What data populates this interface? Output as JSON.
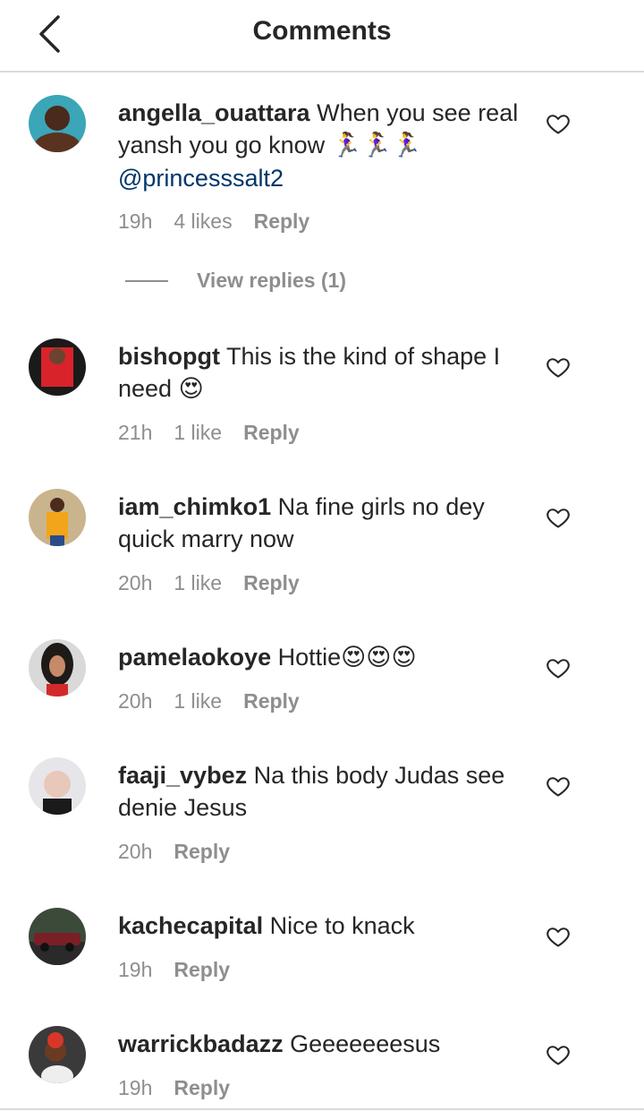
{
  "header": {
    "title": "Comments",
    "back_icon": "chevron-left-icon"
  },
  "comments": [
    {
      "username": "angella_ouattara",
      "text": "When you see real yansh you go know",
      "emoji": "🏃‍♀️🏃‍♀️🏃‍♀️",
      "mention": "@princesssalt2",
      "time": "19h",
      "likes": "4 likes",
      "reply": "Reply"
    },
    {
      "username": "bishopgt",
      "text": "This is the kind of shape I need",
      "emoji": "😍",
      "time": "21h",
      "likes": "1 like",
      "reply": "Reply"
    },
    {
      "username": "iam_chimko1",
      "text": "Na fine girls no dey quick marry now",
      "time": "20h",
      "likes": "1 like",
      "reply": "Reply"
    },
    {
      "username": "pamelaokoye",
      "text": "Hottie",
      "emoji": "😍😍😍",
      "time": "20h",
      "likes": "1 like",
      "reply": "Reply"
    },
    {
      "username": "faaji_vybez",
      "text": "Na this body Judas see denie Jesus",
      "time": "20h",
      "reply": "Reply"
    },
    {
      "username": "kachecapital",
      "text": "Nice to knack",
      "time": "19h",
      "reply": "Reply"
    },
    {
      "username": "warrickbadazz",
      "text": "Geeeeeeesus",
      "time": "19h",
      "reply": "Reply"
    }
  ],
  "view_replies": {
    "label": "View replies (1)"
  },
  "colors": {
    "text": "#262626",
    "secondary": "#8e8e8e",
    "mention": "#003569",
    "divider": "#dbdbdb"
  }
}
